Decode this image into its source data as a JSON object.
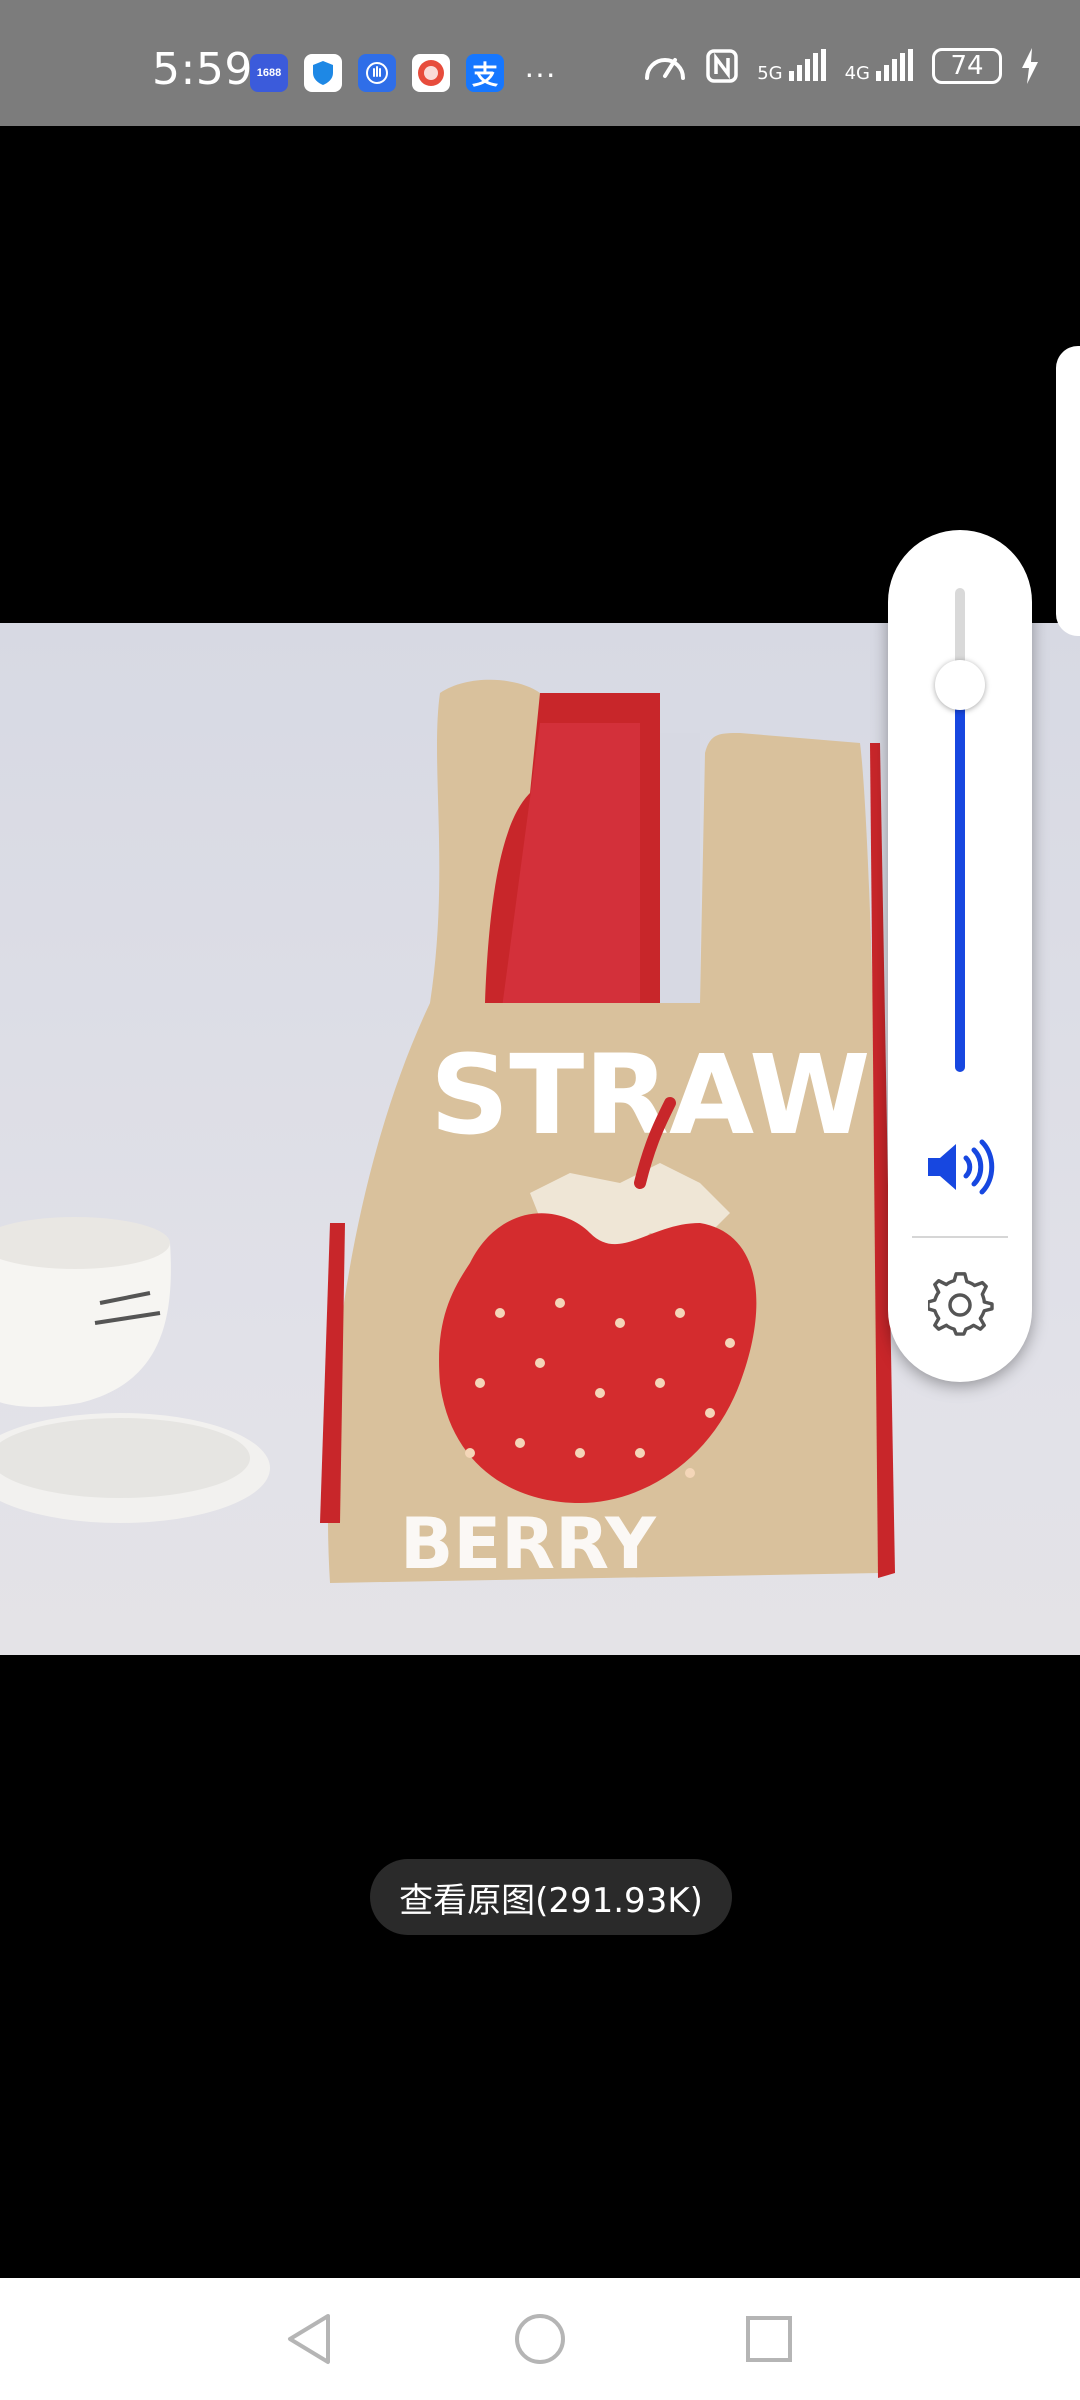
{
  "status_bar": {
    "time": "5:59",
    "notification_icons": [
      {
        "name": "1688-app-icon",
        "label": "1688",
        "color": "#3b5bdb"
      },
      {
        "name": "shield-app-icon",
        "label": "",
        "color": "#1e88e5"
      },
      {
        "name": "hand-app-icon",
        "label": "",
        "color": "#2f6ee8"
      },
      {
        "name": "lottery-app-icon",
        "label": "",
        "color": "#e74c3c"
      },
      {
        "name": "alipay-app-icon",
        "label": "支",
        "color": "#1677ff"
      }
    ],
    "more_indicator": "···",
    "network_5g": "5G",
    "network_4g": "4G",
    "battery_level": "74",
    "charging": true
  },
  "image_viewer": {
    "view_original_label": "查看原图(291.93K)",
    "image_texts": [
      "STRAW",
      "BERRY"
    ]
  },
  "volume_panel": {
    "level_fraction": 0.8,
    "accent_color": "#1747e0"
  },
  "nav_bar": {
    "buttons": [
      "back",
      "home",
      "recents"
    ]
  }
}
